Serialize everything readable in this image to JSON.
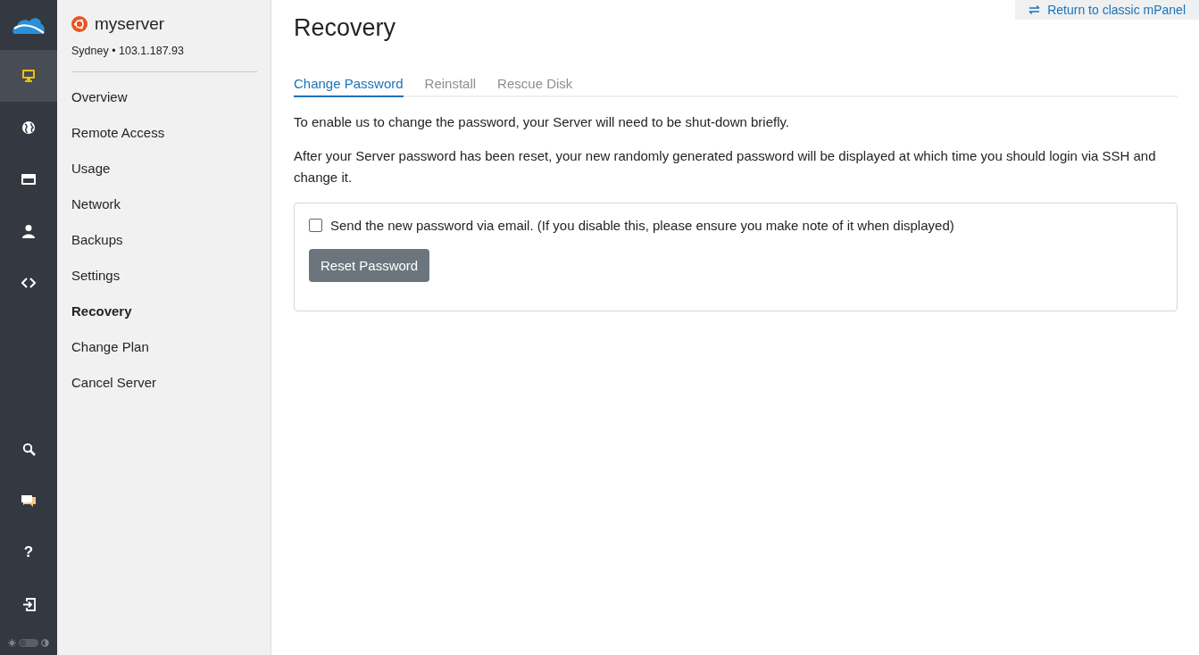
{
  "rail": {
    "top_items": [
      {
        "kind": "monitor",
        "selected": true
      },
      {
        "kind": "globe",
        "selected": false
      },
      {
        "kind": "card",
        "selected": false
      },
      {
        "kind": "person",
        "selected": false
      },
      {
        "kind": "code",
        "selected": false
      }
    ],
    "bottom_items": [
      {
        "kind": "search"
      },
      {
        "kind": "chat"
      },
      {
        "kind": "help",
        "glyph": "?"
      },
      {
        "kind": "logout"
      }
    ],
    "theme_toggle": {
      "on": false
    }
  },
  "server": {
    "name": "myserver",
    "location": "Sydney • 103.1.187.93"
  },
  "sidebar": {
    "items": [
      {
        "label": "Overview",
        "selected": false
      },
      {
        "label": "Remote Access",
        "selected": false
      },
      {
        "label": "Usage",
        "selected": false
      },
      {
        "label": "Network",
        "selected": false
      },
      {
        "label": "Backups",
        "selected": false
      },
      {
        "label": "Settings",
        "selected": false
      },
      {
        "label": "Recovery",
        "selected": true
      },
      {
        "label": "Change Plan",
        "selected": false
      },
      {
        "label": "Cancel Server",
        "selected": false
      }
    ]
  },
  "classic_link": "Return to classic mPanel",
  "title": "Recovery",
  "tabs": [
    {
      "label": "Change Password",
      "selected": true
    },
    {
      "label": "Reinstall",
      "selected": false
    },
    {
      "label": "Rescue Disk",
      "selected": false
    }
  ],
  "paragraphs": [
    "To enable us to change the password, your Server will need to be shut-down briefly.",
    "After your Server password has been reset, your new randomly generated password will be displayed at which time you should login via SSH and change it."
  ],
  "email_option": {
    "label": "Send the new password via email. (If you disable this, please ensure you make note of it when displayed)",
    "checked": false
  },
  "reset_button": "Reset Password"
}
